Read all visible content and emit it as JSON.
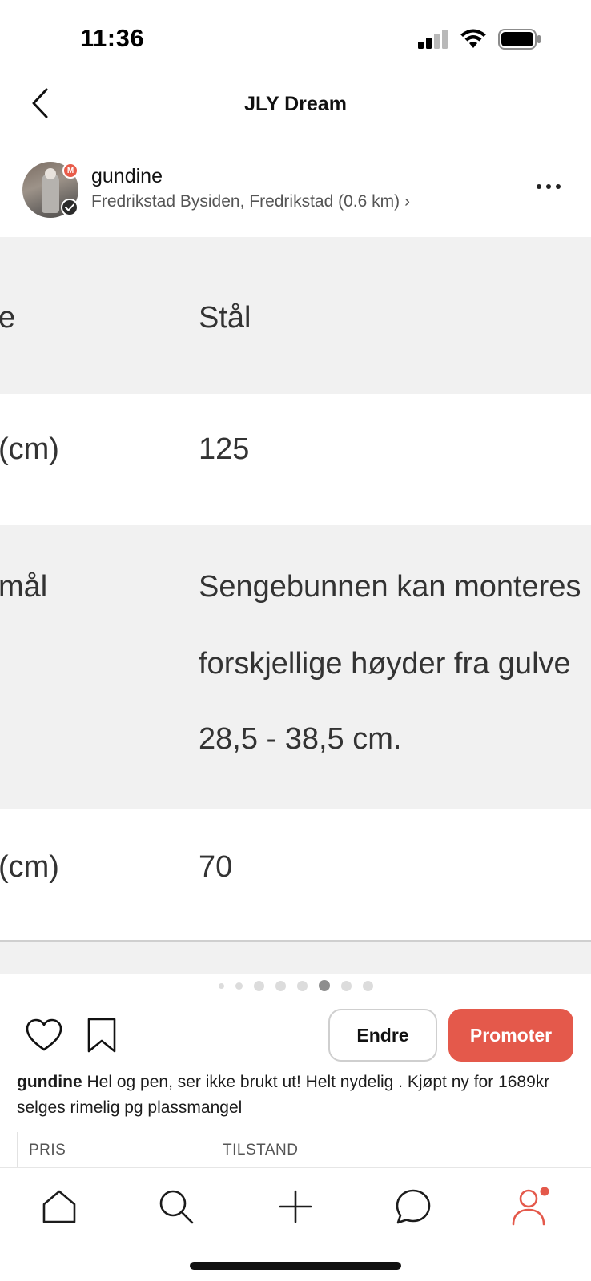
{
  "status_bar": {
    "time": "11:36",
    "icons": [
      "signal-icon",
      "wifi-icon",
      "battery-icon"
    ]
  },
  "header": {
    "title": "JLY Dream",
    "back_icon": "chevron-left-icon"
  },
  "seller": {
    "name": "gundine",
    "location": "Fredrikstad Bysiden, Fredrikstad (0.6 km) ›",
    "badge_letter": "M",
    "verified_icon": "check-icon",
    "more_icon": "ellipsis-icon"
  },
  "photo": {
    "rows": [
      {
        "label": "e",
        "value": "Stål"
      },
      {
        "label": "(cm)",
        "value": "125"
      },
      {
        "label": "mål",
        "lines": [
          "Sengebunnen kan monteres",
          "forskjellige høyder fra gulve",
          "28,5 - 38,5 cm."
        ]
      },
      {
        "label": "(cm)",
        "value": "70"
      }
    ],
    "page_count": 8,
    "active_page": 6
  },
  "actions": {
    "like_icon": "heart-icon",
    "save_icon": "bookmark-icon",
    "edit_label": "Endre",
    "promote_label": "Promoter"
  },
  "description": {
    "user": "gundine",
    "text": " Hel og pen, ser ikke brukt ut! Helt nydelig . Kjøpt ny for 1689kr selges rimelig pg plassmangel"
  },
  "info": {
    "price_label": "PRIS",
    "condition_label": "TILSTAND"
  },
  "tab_bar": {
    "tabs": [
      "home-icon",
      "search-icon",
      "plus-icon",
      "chat-icon",
      "profile-icon"
    ],
    "active_tab": "profile-icon",
    "notification_dot": true
  },
  "colors": {
    "accent": "#e4594b",
    "grey_row": "#f1f1f1",
    "text": "#1c1c1c"
  }
}
